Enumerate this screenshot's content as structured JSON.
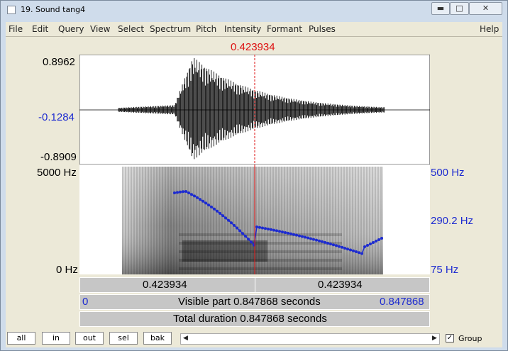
{
  "window": {
    "title": "19. Sound tang4",
    "min_icon": "minimize-icon",
    "max_icon": "maximize-icon",
    "close_icon": "close-icon"
  },
  "menu": [
    "File",
    "Edit",
    "Query",
    "View",
    "Select",
    "Spectrum",
    "Pitch",
    "Intensity",
    "Formant",
    "Pulses"
  ],
  "help": "Help",
  "cursor": {
    "time": "0.423934"
  },
  "waveform": {
    "ymax": "0.8962",
    "ymid": "-0.1284",
    "ymin": "-0.8909"
  },
  "spectrogram": {
    "fmax": "5000 Hz",
    "fmin": "0 Hz"
  },
  "pitch": {
    "max": "500 Hz",
    "mid": "290.2 Hz",
    "min": "75 Hz"
  },
  "bars": {
    "left_duration": "0.423934",
    "right_duration": "0.423934",
    "visible_start": "0",
    "visible_label": "Visible part 0.847868 seconds",
    "visible_end": "0.847868",
    "total_label": "Total duration 0.847868 seconds"
  },
  "bottom_buttons": [
    "all",
    "in",
    "out",
    "sel",
    "bak"
  ],
  "group": {
    "label": "Group",
    "checked": true
  },
  "colors": {
    "pitch": "#1d2bd0",
    "cursor": "#d11"
  }
}
